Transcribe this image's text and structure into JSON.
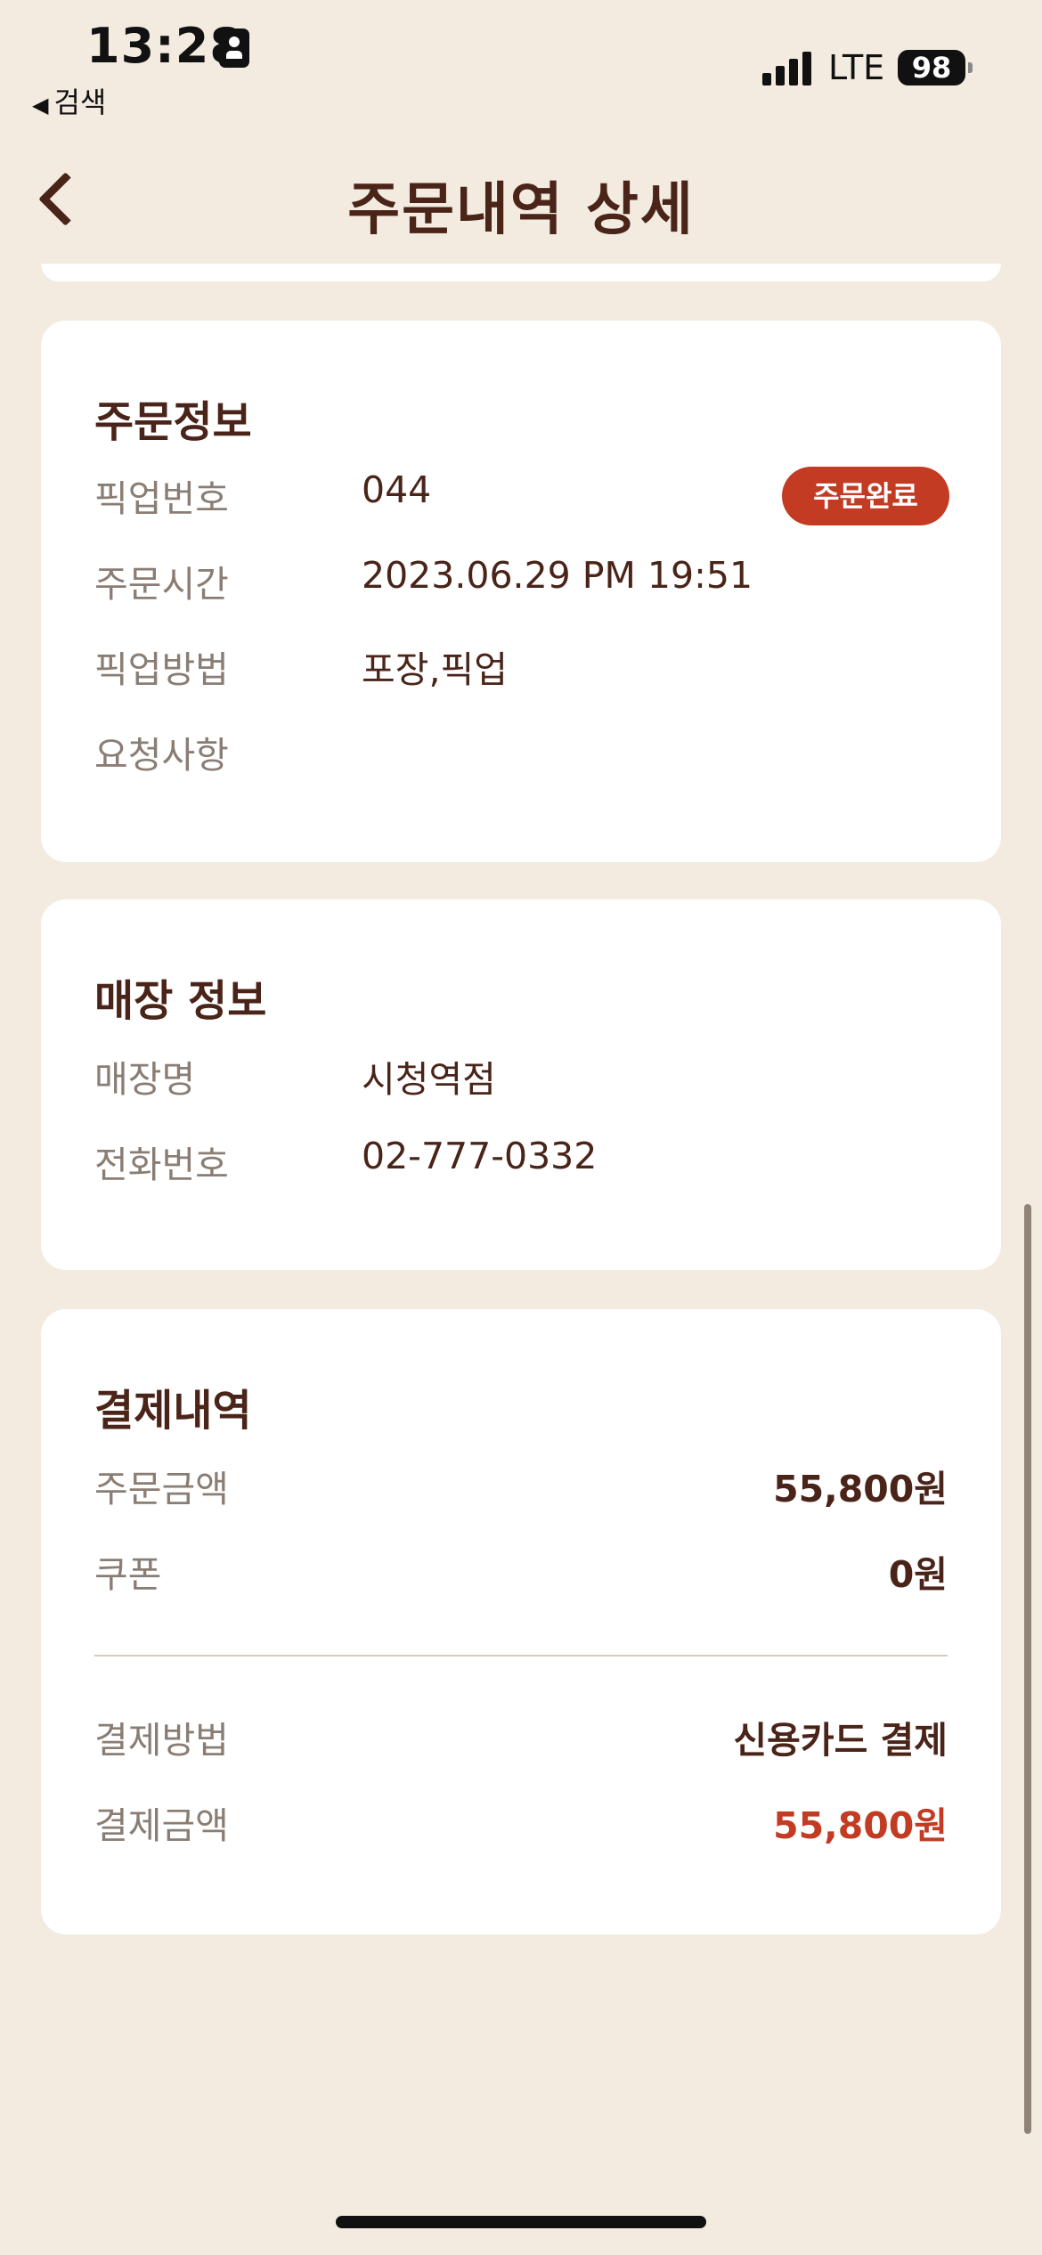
{
  "status_bar": {
    "time": "13:28",
    "back_app": "검색",
    "network": "LTE",
    "battery": "98"
  },
  "header": {
    "title": "주문내역 상세"
  },
  "order_info": {
    "title": "주문정보",
    "pickup_number_label": "픽업번호",
    "pickup_number": "044",
    "status_badge": "주문완료",
    "order_time_label": "주문시간",
    "order_time": "2023.06.29 PM 19:51",
    "pickup_method_label": "픽업방법",
    "pickup_method": "포장,픽업",
    "request_label": "요청사항",
    "request": ""
  },
  "store_info": {
    "title": "매장 정보",
    "store_name_label": "매장명",
    "store_name": "시청역점",
    "phone_label": "전화번호",
    "phone": "02-777-0332"
  },
  "payment": {
    "title": "결제내역",
    "order_amount_label": "주문금액",
    "order_amount": "55,800원",
    "coupon_label": "쿠폰",
    "coupon": "0원",
    "method_label": "결제방법",
    "method": "신용카드 결제",
    "total_label": "결제금액",
    "total": "55,800원"
  },
  "colors": {
    "background": "#f3ebe0",
    "brand_brown": "#4a2418",
    "accent_red": "#c23b22",
    "label_gray": "#8a7d74"
  }
}
